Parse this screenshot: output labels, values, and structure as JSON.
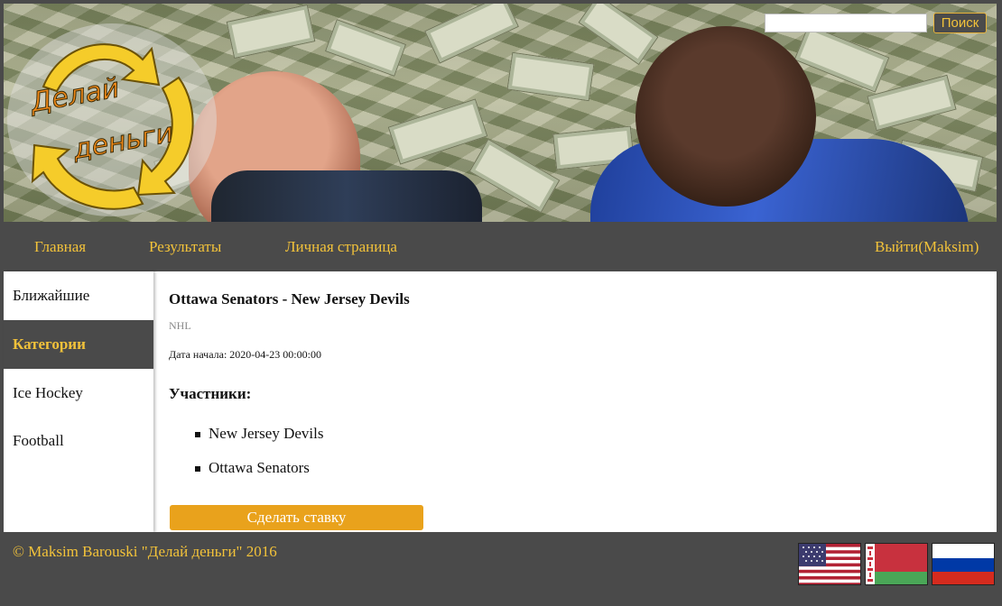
{
  "header": {
    "logo_line1": "Делай",
    "logo_line2": "деньги",
    "search": {
      "placeholder": "",
      "value": "",
      "button_label": "Поиск"
    }
  },
  "nav": {
    "items": [
      {
        "label": "Главная"
      },
      {
        "label": "Результаты"
      },
      {
        "label": "Личная страница"
      }
    ],
    "logout_label": "Выйти(Maksim)"
  },
  "sidebar": {
    "items": [
      {
        "label": "Ближайшие",
        "active": false
      },
      {
        "label": "Категории",
        "active": true
      },
      {
        "label": "Ice Hockey",
        "active": false
      },
      {
        "label": "Football",
        "active": false
      }
    ]
  },
  "event": {
    "title": "Ottawa Senators - New Jersey Devils",
    "league": "NHL",
    "start_label": "Дата начала: 2020-04-23 00:00:00",
    "participants_title": "Участники:",
    "participants": [
      "New Jersey Devils",
      "Ottawa Senators"
    ],
    "bet_button_label": "Сделать ставку"
  },
  "footer": {
    "copyright": "© Maksim Barouski \"Делай деньги\" 2016",
    "languages": [
      {
        "name": "us-flag-icon"
      },
      {
        "name": "by-flag-icon"
      },
      {
        "name": "ru-flag-icon"
      }
    ]
  },
  "colors": {
    "accent": "#f2c23a",
    "bet_button": "#e9a21c",
    "dark_bg": "#4a4a4a"
  }
}
